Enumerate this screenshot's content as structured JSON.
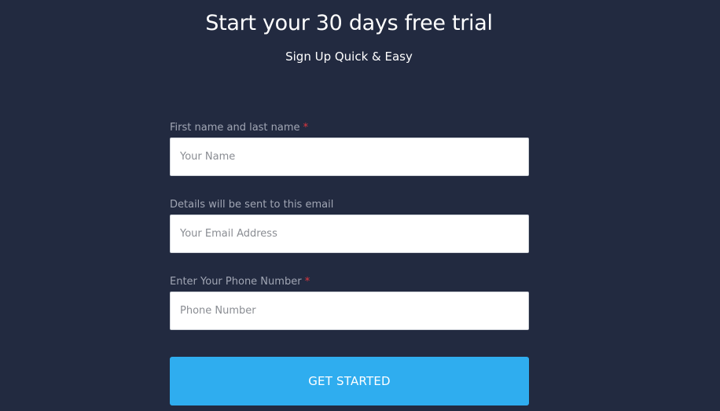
{
  "header": {
    "title": "Start your 30 days free trial",
    "subtitle": "Sign Up Quick & Easy"
  },
  "form": {
    "fields": [
      {
        "label": "First name and last name",
        "required_mark": "*",
        "placeholder": "Your Name",
        "value": ""
      },
      {
        "label": "Details will be sent to this email",
        "required_mark": "",
        "placeholder": "Your Email Address",
        "value": ""
      },
      {
        "label": "Enter Your Phone Number",
        "required_mark": "*",
        "placeholder": "Phone Number",
        "value": ""
      }
    ],
    "submit_label": "GET STARTED"
  },
  "colors": {
    "background": "#222a40",
    "accent": "#2fadef",
    "required": "#e0383e"
  }
}
